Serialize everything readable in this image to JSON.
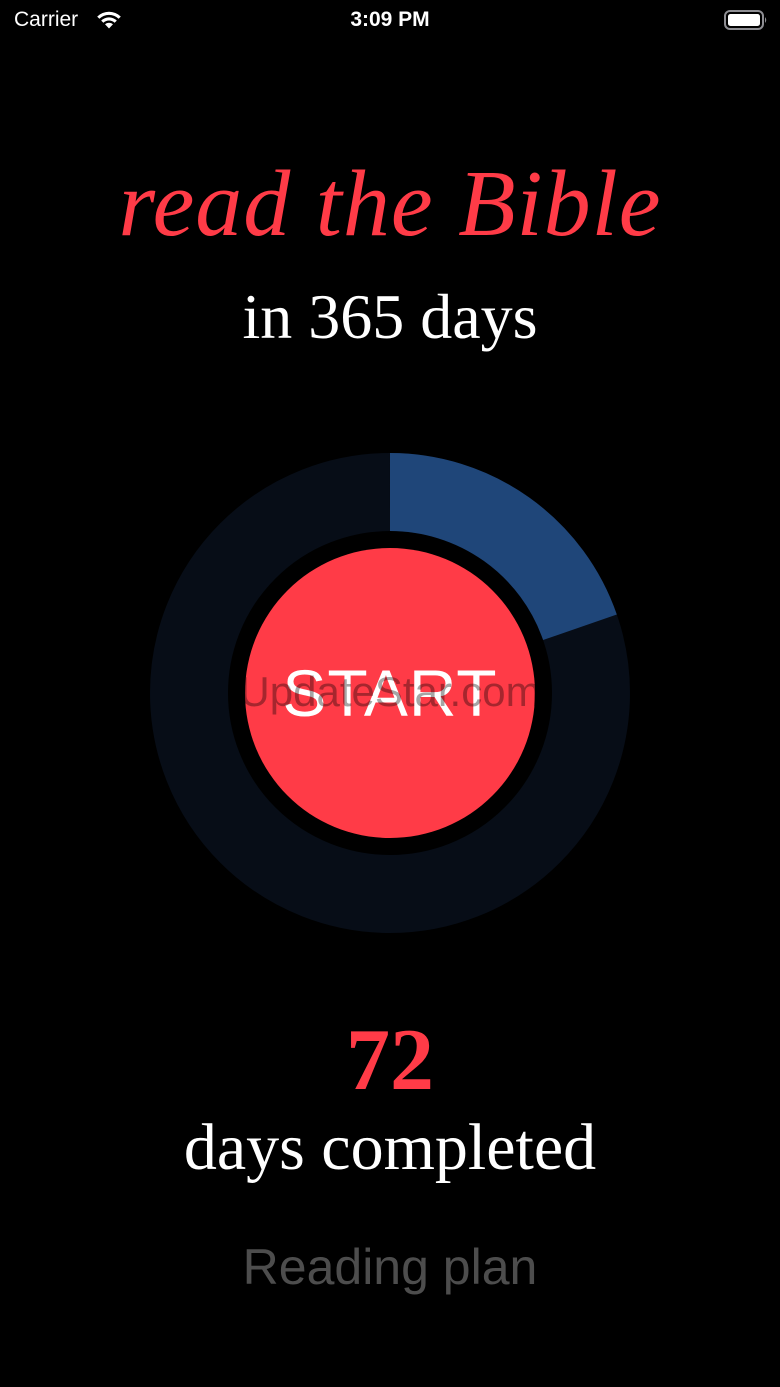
{
  "status_bar": {
    "carrier": "Carrier",
    "time": "3:09 PM",
    "wifi_icon": "wifi-icon",
    "battery_icon": "battery-icon"
  },
  "header": {
    "title_line_1": "read the Bible",
    "title_line_2": "in 365 days"
  },
  "progress": {
    "days_completed": 72,
    "total_days": 365,
    "fraction": 0.197,
    "track_color": "#070d17",
    "fill_color": "#1f4679"
  },
  "start_button": {
    "label": "START",
    "color": "#ff3b47"
  },
  "watermark": "UpdateStar.com",
  "stats": {
    "days_value": "72",
    "days_label": "days completed"
  },
  "footer": {
    "reading_plan_label": "Reading plan"
  },
  "colors": {
    "accent": "#ff3b47",
    "background": "#000000",
    "muted_text": "#4d4d4d"
  }
}
